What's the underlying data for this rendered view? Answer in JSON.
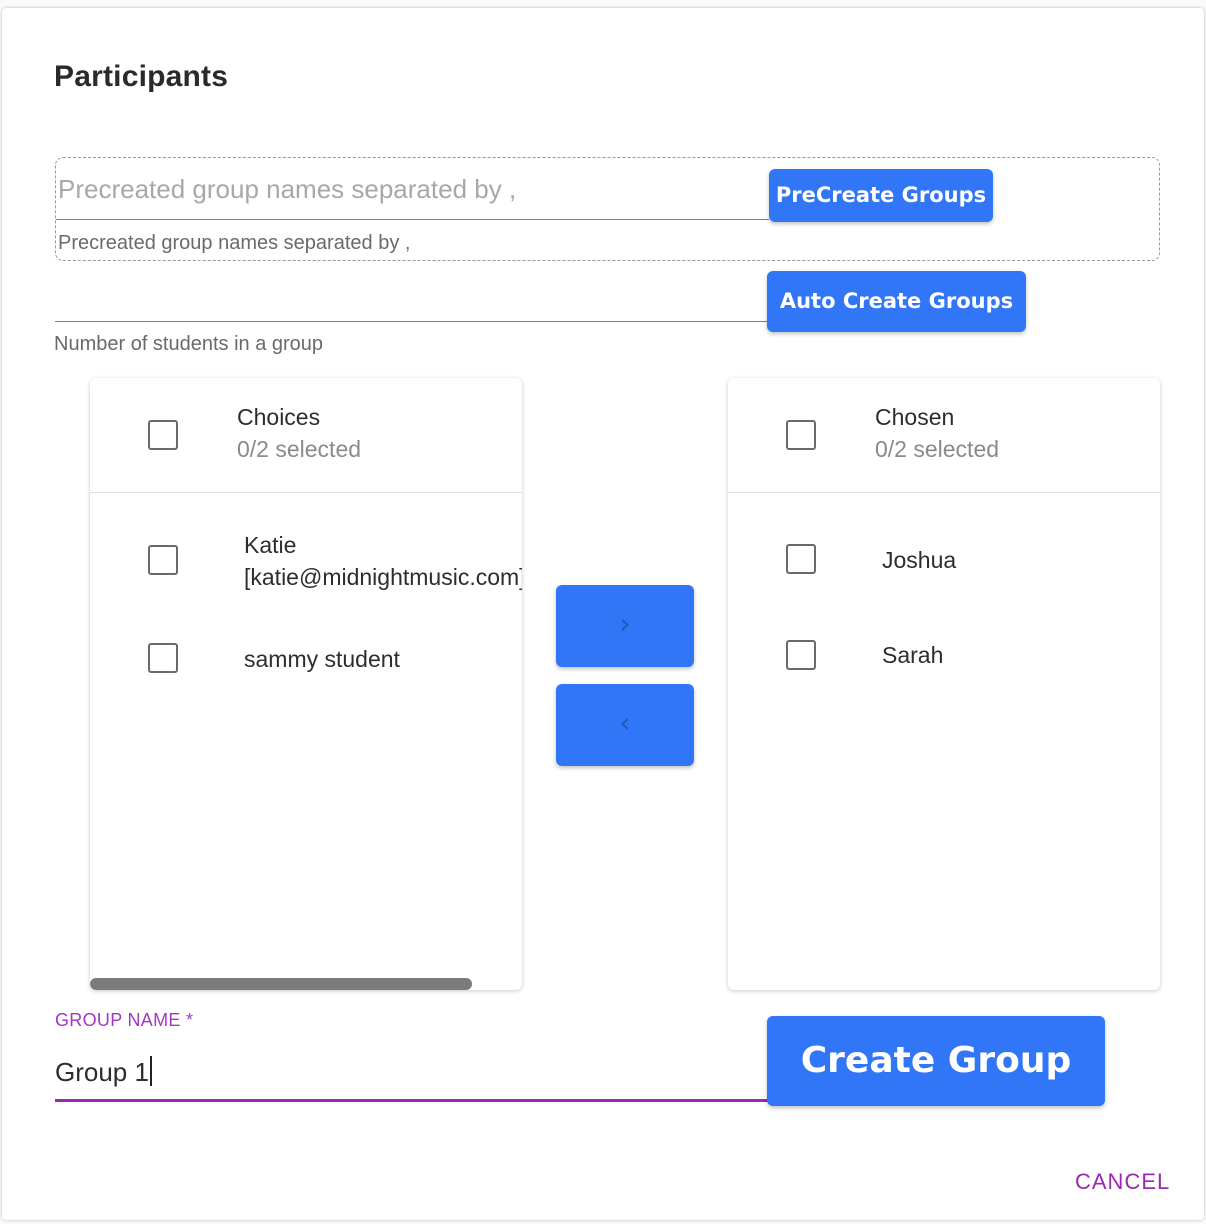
{
  "dialog": {
    "title": "Participants"
  },
  "precreate": {
    "placeholder": "Precreated group names separated by ,",
    "helper": "Precreated group names separated by ,",
    "button_label": "PreCreate Groups"
  },
  "autocreate": {
    "value": "",
    "helper": "Number of students in a group",
    "button_label": "Auto Create Groups"
  },
  "transfer": {
    "left": {
      "title": "Choices",
      "subtitle": "0/2 selected",
      "items": [
        {
          "label_line1": "Katie",
          "label_line2": "[katie@midnightmusic.com]",
          "checked": false
        },
        {
          "label_line1": "sammy student",
          "checked": false
        }
      ]
    },
    "right": {
      "title": "Chosen",
      "subtitle": "0/2 selected",
      "items": [
        {
          "label_line1": "Joshua",
          "checked": false
        },
        {
          "label_line1": "Sarah",
          "checked": false
        }
      ]
    },
    "move_right_icon": "›",
    "move_left_icon": "‹"
  },
  "group_name": {
    "label": "GROUP NAME *",
    "value": "Group 1"
  },
  "actions": {
    "create_label": "Create Group",
    "cancel_label": "CANCEL"
  },
  "colors": {
    "primary": "#3076f6",
    "accent": "#9c27b0"
  }
}
